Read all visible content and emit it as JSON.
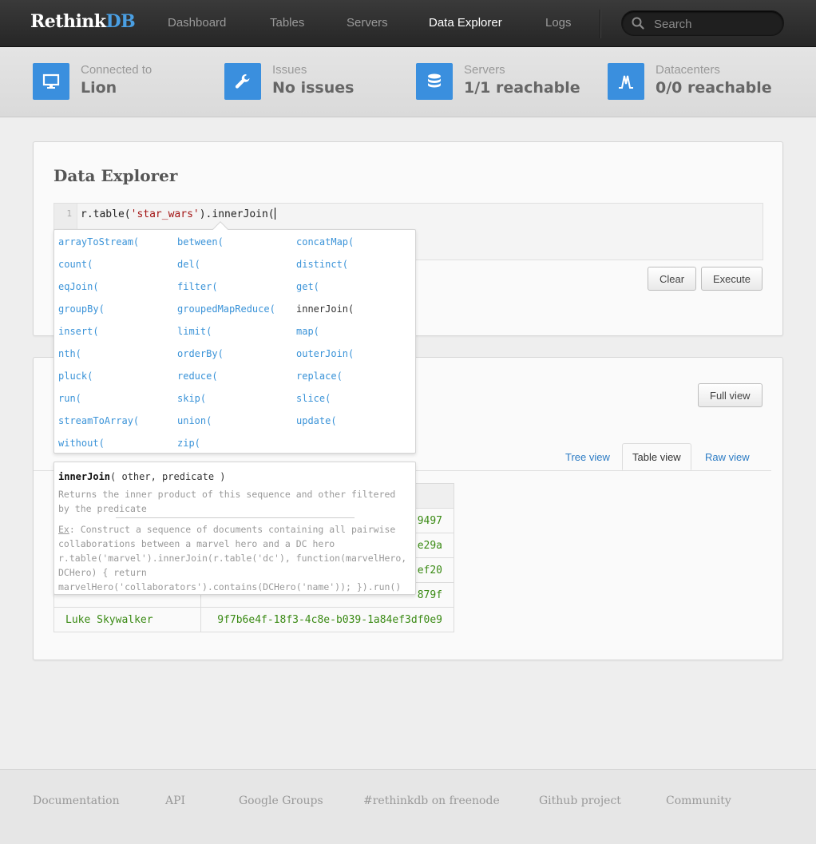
{
  "app": {
    "logo_primary": "Rethink",
    "logo_accent": "DB"
  },
  "nav": {
    "items": [
      {
        "label": "Dashboard",
        "active": false
      },
      {
        "label": "Tables",
        "active": false
      },
      {
        "label": "Servers",
        "active": false
      },
      {
        "label": "Data Explorer",
        "active": true
      },
      {
        "label": "Logs",
        "active": false
      }
    ],
    "search_placeholder": "Search"
  },
  "status": [
    {
      "label": "Connected to",
      "value": "Lion",
      "icon": "monitor-icon"
    },
    {
      "label": "Issues",
      "value": "No issues",
      "icon": "wrench-icon"
    },
    {
      "label": "Servers",
      "value": "1/1 reachable",
      "icon": "database-icon"
    },
    {
      "label": "Datacenters",
      "value": "0/0 reachable",
      "icon": "datacenter-icon"
    }
  ],
  "explorer": {
    "title": "Data Explorer",
    "line_number": "1",
    "code_prefix": "r.table(",
    "code_string": "'star_wars'",
    "code_suffix": ").innerJoin(",
    "clear_label": "Clear",
    "execute_label": "Execute"
  },
  "suggestions": {
    "col1": [
      "arrayToStream(",
      "count(",
      "eqJoin(",
      "groupBy(",
      "insert(",
      "nth(",
      "pluck(",
      "run(",
      "streamToArray(",
      "without("
    ],
    "col2": [
      "between(",
      "del(",
      "filter(",
      "groupedMapReduce(",
      "limit(",
      "orderBy(",
      "reduce(",
      "skip(",
      "union(",
      "zip("
    ],
    "col3": [
      "concatMap(",
      "distinct(",
      "get(",
      "innerJoin(",
      "map(",
      "outerJoin(",
      "replace(",
      "slice(",
      "update("
    ],
    "selected": "innerJoin("
  },
  "doc": {
    "name": "innerJoin",
    "args": "( other, predicate )",
    "description": "Returns the inner product of this sequence and other filtered by the predicate",
    "ex_label": "Ex",
    "example": ": Construct a sequence of documents containing all pairwise collaborations between a marvel hero and a DC hero r.table('marvel').innerJoin(r.table('dc'), function(marvelHero, DCHero) { return marvelHero('collaborators').contains(DCHero('name')); }).run()"
  },
  "results": {
    "full_view_label": "Full view",
    "tabs": [
      {
        "label": "Tree view",
        "active": false
      },
      {
        "label": "Table view",
        "active": true
      },
      {
        "label": "Raw view",
        "active": false
      }
    ],
    "rows": [
      {
        "name": "",
        "id": "9497"
      },
      {
        "name": "",
        "id": "e29a"
      },
      {
        "name": "",
        "id": "ef20"
      },
      {
        "name": "",
        "id": "879f"
      },
      {
        "name": "Luke Skywalker",
        "id": "9f7b6e4f-18f3-4c8e-b039-1a84ef3df0e9"
      }
    ]
  },
  "footer": {
    "links": [
      "Documentation",
      "API",
      "Google Groups",
      "#rethinkdb on freenode",
      "Github project",
      "Community"
    ]
  },
  "colors": {
    "accent": "#3a8fde",
    "nav_bg": "#2e2e2e",
    "result_text": "#3a8a14",
    "link": "#2b7bc4"
  }
}
